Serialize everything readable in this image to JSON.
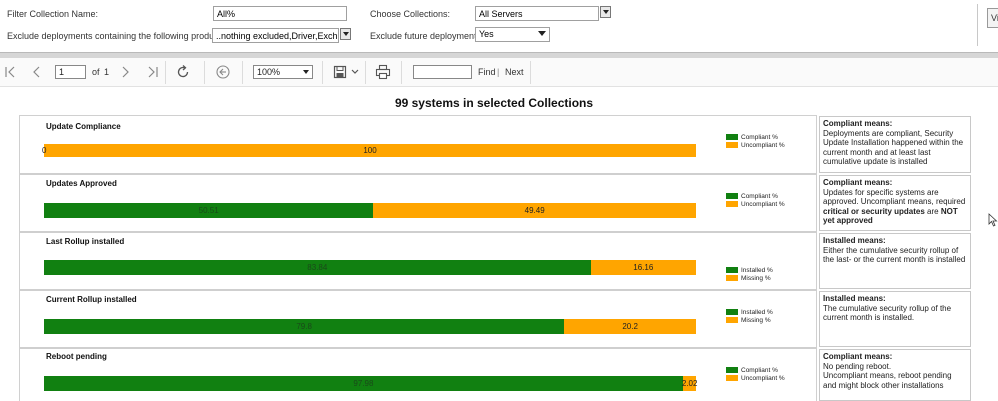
{
  "params": {
    "filter_label": "Filter Collection Name:",
    "filter_value": "All%",
    "exclude_label": "Exclude deployments containing the following products:",
    "exclude_value": "..nothing excluded,Driver,Exchang",
    "collections_label": "Choose Collections:",
    "collections_value": "All Servers",
    "future_label": "Exclude future deployments",
    "future_value": "Yes",
    "view_button": "Vi"
  },
  "toolbar": {
    "page_value": "1",
    "of_label": "of",
    "total_pages": "1",
    "zoom_value": "100%",
    "find_label": "Find",
    "find_sep": "|",
    "next_label": "Next"
  },
  "report": {
    "title": "99 systems in selected Collections",
    "rows": [
      {
        "label": "Update Compliance",
        "green_value": "0",
        "orange_value": "100",
        "green_pct": 0,
        "orange_pct": 100,
        "legend_green": "Compliant %",
        "legend_orange": "Uncompliant %",
        "desc_title": "Compliant means:",
        "desc_text": "Deployments are compliant, Security Update Installation happened within the current month and at least last cumulative update is installed"
      },
      {
        "label": "Updates Approved",
        "green_value": "50.51",
        "orange_value": "49.49",
        "green_pct": 50.51,
        "orange_pct": 49.49,
        "legend_green": "Compliant %",
        "legend_orange": "Uncompliant %",
        "desc_title": "Compliant means:",
        "desc_text_1": "Updates for specific systems are approved. Uncompliant means, required ",
        "desc_bold": "critical or security updates",
        "desc_text_2": " are ",
        "desc_bold_2": "NOT yet approved"
      },
      {
        "label": "Last Rollup installed",
        "green_value": "83.84",
        "orange_value": "16.16",
        "green_pct": 83.84,
        "orange_pct": 16.16,
        "legend_green": "Installed %",
        "legend_orange": "Missing %",
        "desc_title": "Installed means:",
        "desc_text": "Either the cumulative security rollup of the last- or the current month is installed"
      },
      {
        "label": "Current Rollup installed",
        "green_value": "79.8",
        "orange_value": "20.2",
        "green_pct": 79.8,
        "orange_pct": 20.2,
        "legend_green": "Installed %",
        "legend_orange": "Missing %",
        "desc_title": "Installed means:",
        "desc_text": "The cumulative security rollup of  the current month is installed."
      },
      {
        "label": "Reboot pending",
        "green_value": "97.98",
        "orange_value": "2.02",
        "green_pct": 97.98,
        "orange_pct": 2.02,
        "legend_green": "Compliant %",
        "legend_orange": "Uncompliant %",
        "desc_title": "Compliant means:",
        "desc_line_1": "No pending reboot.",
        "desc_line_2": "Uncompliant means, reboot pending and might block other installations"
      }
    ]
  },
  "colors": {
    "green": "#118011",
    "orange": "#ffa500"
  },
  "chart_data": [
    {
      "type": "bar",
      "title": "Update Compliance",
      "series": [
        {
          "name": "Compliant %",
          "values": [
            0
          ]
        },
        {
          "name": "Uncompliant %",
          "values": [
            100
          ]
        }
      ],
      "stacked": true
    },
    {
      "type": "bar",
      "title": "Updates Approved",
      "series": [
        {
          "name": "Compliant %",
          "values": [
            50.51
          ]
        },
        {
          "name": "Uncompliant %",
          "values": [
            49.49
          ]
        }
      ],
      "stacked": true
    },
    {
      "type": "bar",
      "title": "Last Rollup installed",
      "series": [
        {
          "name": "Installed %",
          "values": [
            83.84
          ]
        },
        {
          "name": "Missing %",
          "values": [
            16.16
          ]
        }
      ],
      "stacked": true
    },
    {
      "type": "bar",
      "title": "Current Rollup installed",
      "series": [
        {
          "name": "Installed %",
          "values": [
            79.8
          ]
        },
        {
          "name": "Missing %",
          "values": [
            20.2
          ]
        }
      ],
      "stacked": true
    },
    {
      "type": "bar",
      "title": "Reboot pending",
      "series": [
        {
          "name": "Compliant %",
          "values": [
            97.98
          ]
        },
        {
          "name": "Uncompliant %",
          "values": [
            2.02
          ]
        }
      ],
      "stacked": true
    }
  ]
}
